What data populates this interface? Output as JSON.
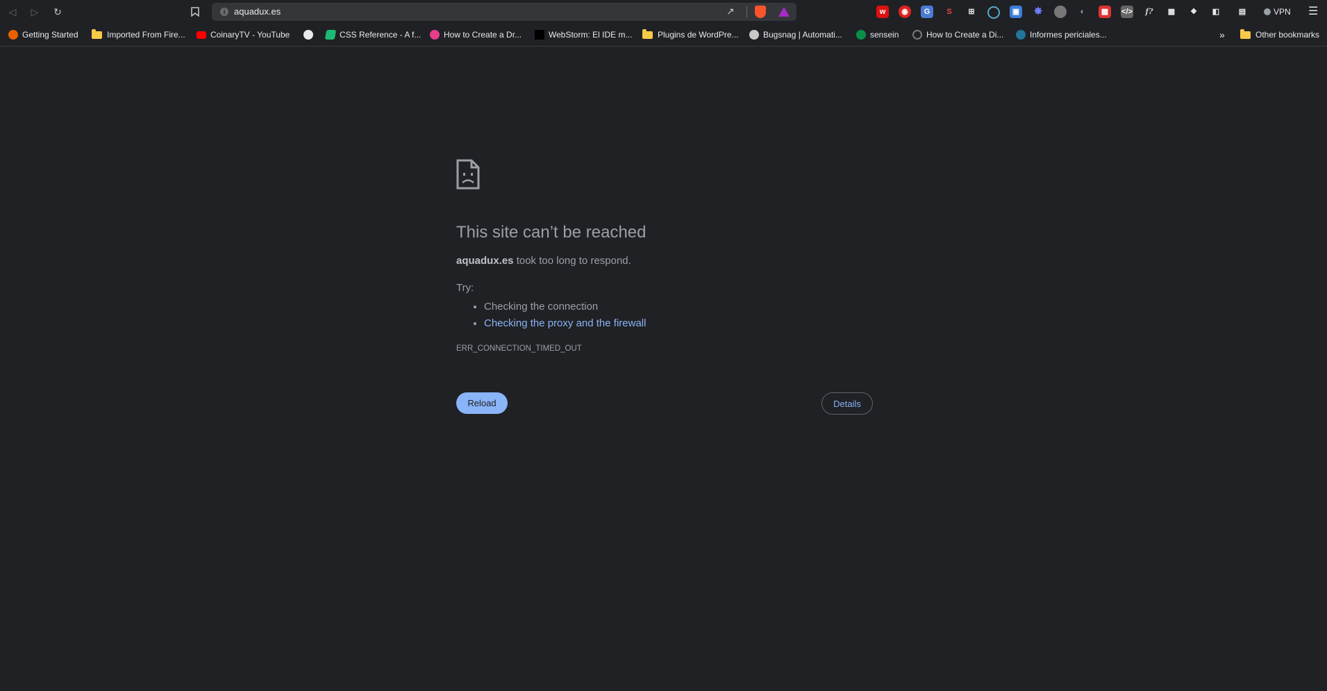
{
  "browser": {
    "url": "aquadux.es",
    "vpn_label": "VPN",
    "overflow_label": "»"
  },
  "bookmarks": [
    {
      "label": "Getting Started",
      "icon": "firefox-icon",
      "color": "#e66000"
    },
    {
      "label": "Imported From Fire...",
      "icon": "folder-icon",
      "color": "#f7c948"
    },
    {
      "label": "CoinaryTV - YouTube",
      "icon": "youtube-icon",
      "color": "#ff0000"
    },
    {
      "label": "",
      "icon": "globe-icon",
      "color": "#e8eaed"
    },
    {
      "label": "CSS Reference - A f...",
      "icon": "css-reference-icon",
      "color": "#1db975"
    },
    {
      "label": "How to Create a Dr...",
      "icon": "pink-asterisk-icon",
      "color": "#e33e8a"
    },
    {
      "label": "WebStorm: El IDE m...",
      "icon": "webstorm-icon",
      "color": "#000000"
    },
    {
      "label": "Plugins de WordPre...",
      "icon": "folder-icon",
      "color": "#f7c948"
    },
    {
      "label": "Bugsnag | Automati...",
      "icon": "bugsnag-icon",
      "color": "#e8eaed"
    },
    {
      "label": "sensein",
      "icon": "sensein-icon",
      "color": "#0a8f4a"
    },
    {
      "label": "How to Create a Di...",
      "icon": "spinner-icon",
      "color": "#7a7a7a"
    },
    {
      "label": "Informes periciales...",
      "icon": "wordpress-icon",
      "color": "#21759b"
    }
  ],
  "other_bookmarks": "Other bookmarks",
  "error": {
    "title": "This site can’t be reached",
    "host": "aquadux.es",
    "message": "took too long to respond.",
    "try_label": "Try:",
    "suggestions": [
      "Checking the connection",
      "Checking the proxy and the firewall"
    ],
    "code": "ERR_CONNECTION_TIMED_OUT",
    "reload_label": "Reload",
    "details_label": "Details"
  },
  "colors": {
    "background": "#202124",
    "text": "#9aa0a6",
    "link": "#8ab4f8",
    "button": "#8ab4f8"
  }
}
